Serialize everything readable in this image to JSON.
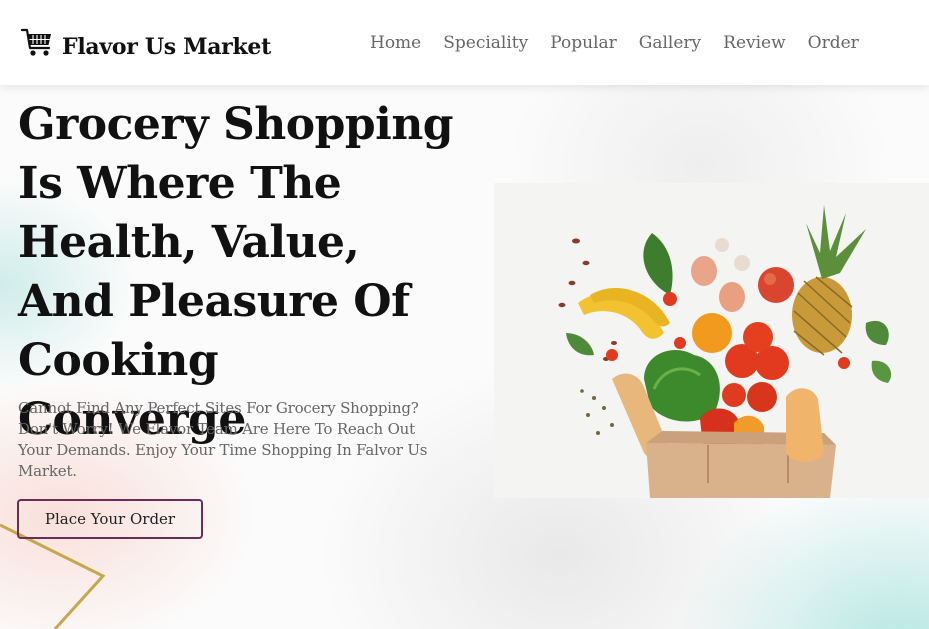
{
  "brand": {
    "name": "Flavor Us Market",
    "icon": "shopping-cart-icon"
  },
  "nav": {
    "items": [
      "Home",
      "Speciality",
      "Popular",
      "Gallery",
      "Review",
      "Order"
    ]
  },
  "hero": {
    "headline": "Grocery Shopping Is Where The Health, Value, And Pleasure Of Cooking Converge",
    "subtext": "Cannot Find Any Perfect Sites For Grocery Shopping? Don't Worry! We Flavor Team Are Here To Reach Out Your Demands. Enjoy Your Time Shopping In Falvor Us Market.",
    "cta_label": "Place Your Order",
    "image": "grocery-bag-with-fruits-and-vegetables"
  },
  "colors": {
    "button_border": "#6b2d55",
    "heading": "#111111",
    "nav_text": "#666666",
    "accent_gold": "#c8a64a",
    "background_teal": "#a0e1dc"
  }
}
